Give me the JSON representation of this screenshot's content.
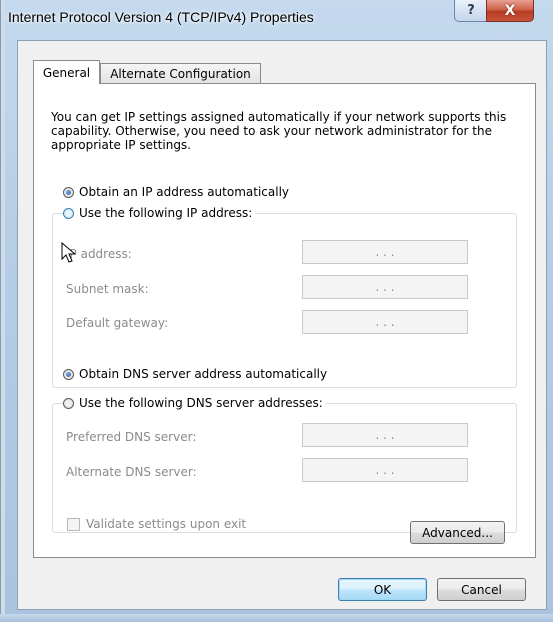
{
  "window": {
    "title": "Internet Protocol Version 4 (TCP/IPv4) Properties",
    "help_glyph": "?",
    "close_glyph": "X"
  },
  "tabs": [
    {
      "label": "General",
      "selected": true
    },
    {
      "label": "Alternate Configuration",
      "selected": false
    }
  ],
  "description": "You can get IP settings assigned automatically if your network supports this capability. Otherwise, you need to ask your network administrator for the appropriate IP settings.",
  "ip": {
    "auto_label": "Obtain an IP address automatically",
    "manual_label": "Use the following IP address:",
    "auto_selected": true,
    "fields": [
      {
        "label": "IP address:",
        "value": ". . ."
      },
      {
        "label": "Subnet mask:",
        "value": ". . ."
      },
      {
        "label": "Default gateway:",
        "value": ". . ."
      }
    ]
  },
  "dns": {
    "auto_label": "Obtain DNS server address automatically",
    "manual_label": "Use the following DNS server addresses:",
    "auto_selected": true,
    "fields": [
      {
        "label": "Preferred DNS server:",
        "value": ". . ."
      },
      {
        "label": "Alternate DNS server:",
        "value": ". . ."
      }
    ]
  },
  "validate_label": "Validate settings upon exit",
  "buttons": {
    "advanced": "Advanced...",
    "ok": "OK",
    "cancel": "Cancel"
  },
  "colors": {
    "accent": "#3c7fb1",
    "disabled_text": "#8b8b8b",
    "close_button": "#c8553a"
  }
}
